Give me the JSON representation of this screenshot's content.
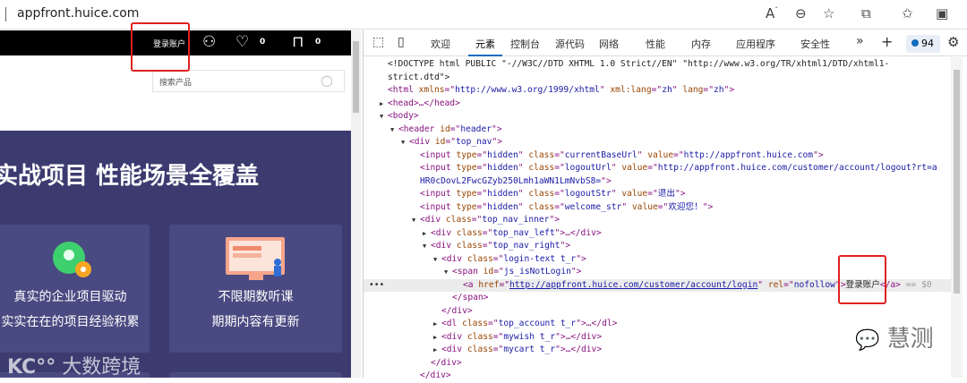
{
  "browser": {
    "url": "appfront.huice.com"
  },
  "site": {
    "login": "登录账户",
    "wish_count": "0",
    "cart_count": "0",
    "search_placeholder": "搜索产品",
    "headline": "实战项目 性能场景全覆盖",
    "cards": [
      {
        "t1": "真实的企业项目驱动",
        "t2": "实实在在的项目经验积累"
      },
      {
        "t1": "不限期数听课",
        "t2": "期期内容有更新"
      }
    ],
    "watermark": "大数跨境"
  },
  "devtools": {
    "tabs": [
      "欢迎",
      "元素",
      "控制台",
      "源代码",
      "网络",
      "性能",
      "内存",
      "应用程序",
      "安全性"
    ],
    "active_tab": "元素",
    "issues": "94",
    "tree": [
      {
        "i": 0,
        "t": "",
        "p": [
          [
            "c-tx",
            "<!DOCTYPE html PUBLIC \"-//W3C//DTD XHTML 1.0 Strict//EN\" \"http://www.w3.org/TR/xhtml1/DTD/xhtml1-"
          ]
        ]
      },
      {
        "i": 0,
        "t": "",
        "p": [
          [
            "c-tx",
            "strict.dtd\">"
          ]
        ]
      },
      {
        "i": 0,
        "t": "",
        "p": [
          [
            "c-tag",
            "<html "
          ],
          [
            "c-an",
            "xmlns"
          ],
          [
            "c-tag",
            "=\""
          ],
          [
            "c-av",
            "http://www.w3.org/1999/xhtml"
          ],
          [
            "c-tag",
            "\" "
          ],
          [
            "c-an",
            "xml:lang"
          ],
          [
            "c-tag",
            "=\""
          ],
          [
            "c-av",
            "zh"
          ],
          [
            "c-tag",
            "\" "
          ],
          [
            "c-an",
            "lang"
          ],
          [
            "c-tag",
            "=\""
          ],
          [
            "c-av",
            "zh"
          ],
          [
            "c-tag",
            "\">"
          ]
        ]
      },
      {
        "i": 0,
        "t": "▶",
        "p": [
          [
            "c-tag",
            "<head>…</head>"
          ]
        ]
      },
      {
        "i": 0,
        "t": "▼",
        "p": [
          [
            "c-tag",
            "<body>"
          ]
        ]
      },
      {
        "i": 1,
        "t": "▼",
        "p": [
          [
            "c-tag",
            "<header "
          ],
          [
            "c-an",
            "id"
          ],
          [
            "c-tag",
            "=\""
          ],
          [
            "c-av",
            "header"
          ],
          [
            "c-tag",
            "\">"
          ]
        ]
      },
      {
        "i": 2,
        "t": "▼",
        "p": [
          [
            "c-tag",
            "<div "
          ],
          [
            "c-an",
            "id"
          ],
          [
            "c-tag",
            "=\""
          ],
          [
            "c-av",
            "top_nav"
          ],
          [
            "c-tag",
            "\">"
          ]
        ]
      },
      {
        "i": 3,
        "t": "",
        "p": [
          [
            "c-tag",
            "<input "
          ],
          [
            "c-an",
            "type"
          ],
          [
            "c-tag",
            "=\""
          ],
          [
            "c-av",
            "hidden"
          ],
          [
            "c-tag",
            "\" "
          ],
          [
            "c-an",
            "class"
          ],
          [
            "c-tag",
            "=\""
          ],
          [
            "c-av",
            "currentBaseUrl"
          ],
          [
            "c-tag",
            "\" "
          ],
          [
            "c-an",
            "value"
          ],
          [
            "c-tag",
            "=\""
          ],
          [
            "c-av",
            "http://appfront.huice.com"
          ],
          [
            "c-tag",
            "\">"
          ]
        ]
      },
      {
        "i": 3,
        "t": "",
        "p": [
          [
            "c-tag",
            "<input "
          ],
          [
            "c-an",
            "type"
          ],
          [
            "c-tag",
            "=\""
          ],
          [
            "c-av",
            "hidden"
          ],
          [
            "c-tag",
            "\" "
          ],
          [
            "c-an",
            "class"
          ],
          [
            "c-tag",
            "=\""
          ],
          [
            "c-av",
            "logoutUrl"
          ],
          [
            "c-tag",
            "\" "
          ],
          [
            "c-an",
            "value"
          ],
          [
            "c-tag",
            "=\""
          ],
          [
            "c-av",
            "http://appfront.huice.com/customer/account/logout?rt=a"
          ]
        ]
      },
      {
        "i": 3,
        "t": "",
        "p": [
          [
            "c-av",
            "HR0cDovL2FwcGZyb250Lmh1aWN1LmNvbS8="
          ],
          [
            "c-tag",
            "\">"
          ]
        ]
      },
      {
        "i": 3,
        "t": "",
        "p": [
          [
            "c-tag",
            "<input "
          ],
          [
            "c-an",
            "type"
          ],
          [
            "c-tag",
            "=\""
          ],
          [
            "c-av",
            "hidden"
          ],
          [
            "c-tag",
            "\" "
          ],
          [
            "c-an",
            "class"
          ],
          [
            "c-tag",
            "=\""
          ],
          [
            "c-av",
            "logoutStr"
          ],
          [
            "c-tag",
            "\" "
          ],
          [
            "c-an",
            "value"
          ],
          [
            "c-tag",
            "=\""
          ],
          [
            "c-av",
            "退出"
          ],
          [
            "c-tag",
            "\">"
          ]
        ]
      },
      {
        "i": 3,
        "t": "",
        "p": [
          [
            "c-tag",
            "<input "
          ],
          [
            "c-an",
            "type"
          ],
          [
            "c-tag",
            "=\""
          ],
          [
            "c-av",
            "hidden"
          ],
          [
            "c-tag",
            "\" "
          ],
          [
            "c-an",
            "class"
          ],
          [
            "c-tag",
            "=\""
          ],
          [
            "c-av",
            "welcome_str"
          ],
          [
            "c-tag",
            "\" "
          ],
          [
            "c-an",
            "value"
          ],
          [
            "c-tag",
            "=\""
          ],
          [
            "c-av",
            "欢迎您！"
          ],
          [
            "c-tag",
            "\">"
          ]
        ]
      },
      {
        "i": 3,
        "t": "▼",
        "p": [
          [
            "c-tag",
            "<div "
          ],
          [
            "c-an",
            "class"
          ],
          [
            "c-tag",
            "=\""
          ],
          [
            "c-av",
            "top_nav_inner"
          ],
          [
            "c-tag",
            "\">"
          ]
        ]
      },
      {
        "i": 4,
        "t": "▶",
        "p": [
          [
            "c-tag",
            "<div "
          ],
          [
            "c-an",
            "class"
          ],
          [
            "c-tag",
            "=\""
          ],
          [
            "c-av",
            "top_nav_left"
          ],
          [
            "c-tag",
            "\">…</div>"
          ]
        ]
      },
      {
        "i": 4,
        "t": "▼",
        "p": [
          [
            "c-tag",
            "<div "
          ],
          [
            "c-an",
            "class"
          ],
          [
            "c-tag",
            "=\""
          ],
          [
            "c-av",
            "top_nav_right"
          ],
          [
            "c-tag",
            "\">"
          ]
        ]
      },
      {
        "i": 5,
        "t": "▼",
        "p": [
          [
            "c-tag",
            "<div "
          ],
          [
            "c-an",
            "class"
          ],
          [
            "c-tag",
            "=\""
          ],
          [
            "c-av",
            "login-text t_r"
          ],
          [
            "c-tag",
            "\">"
          ]
        ]
      },
      {
        "i": 6,
        "t": "▼",
        "p": [
          [
            "c-tag",
            "<span "
          ],
          [
            "c-an",
            "id"
          ],
          [
            "c-tag",
            "=\""
          ],
          [
            "c-av",
            "js_isNotLogin"
          ],
          [
            "c-tag",
            "\">"
          ]
        ]
      },
      {
        "i": 7,
        "t": "",
        "sel": true,
        "p": [
          [
            "c-tag",
            "<a "
          ],
          [
            "c-an",
            "href"
          ],
          [
            "c-tag",
            "=\""
          ],
          [
            "c-link",
            "http://appfront.huice.com/customer/account/login"
          ],
          [
            "c-tag",
            "\" "
          ],
          [
            "c-an",
            "rel"
          ],
          [
            "c-tag",
            "=\""
          ],
          [
            "c-av",
            "nofollow"
          ],
          [
            "c-tag",
            "\">"
          ],
          [
            "c-tx",
            "登录账户"
          ],
          [
            "c-tag",
            "</a>"
          ],
          [
            "c-dim",
            " == $0"
          ]
        ]
      },
      {
        "i": 6,
        "t": "",
        "p": [
          [
            "c-tag",
            "</span>"
          ]
        ]
      },
      {
        "i": 5,
        "t": "",
        "p": [
          [
            "c-tag",
            "</div>"
          ]
        ]
      },
      {
        "i": 5,
        "t": "▶",
        "p": [
          [
            "c-tag",
            "<dl "
          ],
          [
            "c-an",
            "class"
          ],
          [
            "c-tag",
            "=\""
          ],
          [
            "c-av",
            "top_account t_r"
          ],
          [
            "c-tag",
            "\">…</dl>"
          ]
        ]
      },
      {
        "i": 5,
        "t": "▶",
        "p": [
          [
            "c-tag",
            "<div "
          ],
          [
            "c-an",
            "class"
          ],
          [
            "c-tag",
            "=\""
          ],
          [
            "c-av",
            "mywish t_r"
          ],
          [
            "c-tag",
            "\">…</div>"
          ]
        ]
      },
      {
        "i": 5,
        "t": "▶",
        "p": [
          [
            "c-tag",
            "<div "
          ],
          [
            "c-an",
            "class"
          ],
          [
            "c-tag",
            "=\""
          ],
          [
            "c-av",
            "mycart t_r"
          ],
          [
            "c-tag",
            "\">…</div>"
          ]
        ]
      },
      {
        "i": 4,
        "t": "",
        "p": [
          [
            "c-tag",
            "</div>"
          ]
        ]
      },
      {
        "i": 3,
        "t": "",
        "p": [
          [
            "c-tag",
            "</div>"
          ]
        ]
      }
    ]
  },
  "wechat_watermark": "慧测"
}
